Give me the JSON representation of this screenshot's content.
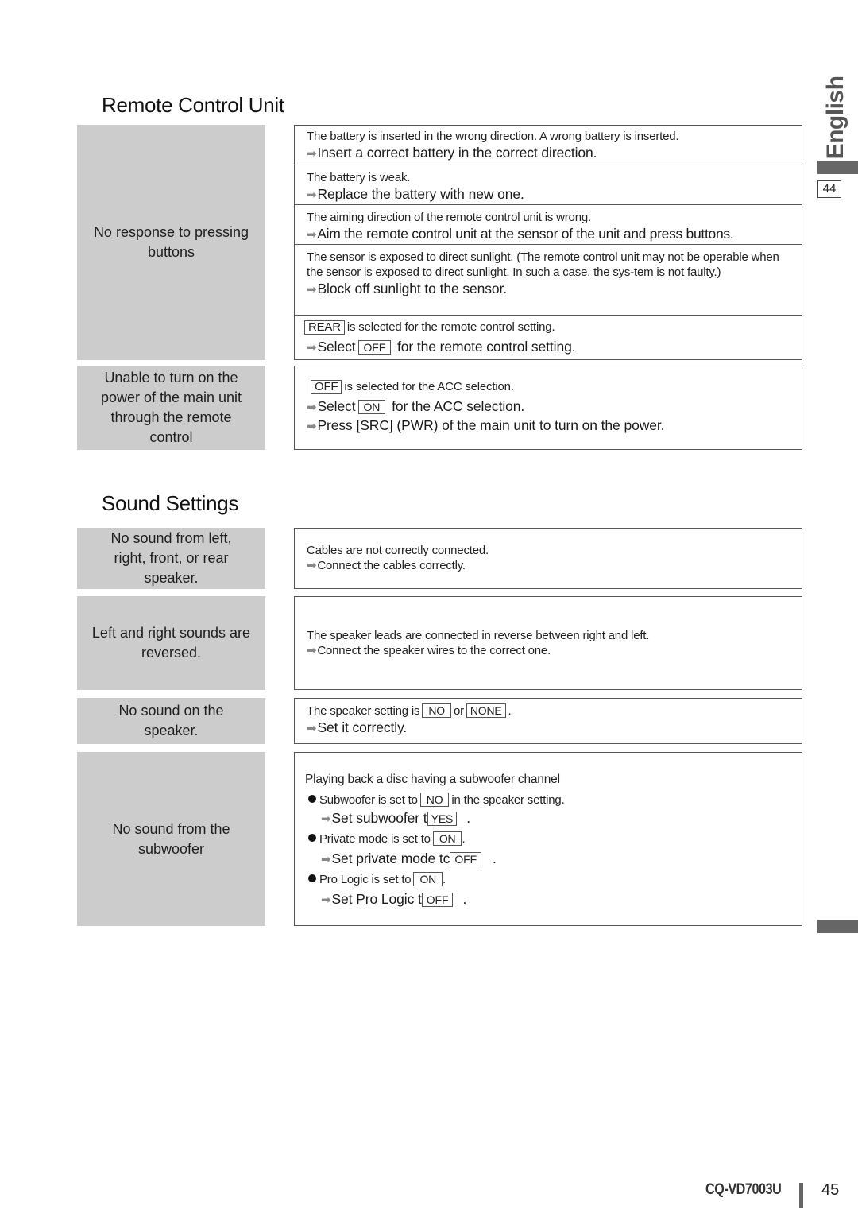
{
  "side_tab": {
    "language": "English",
    "page_ref": "44"
  },
  "footer": {
    "model": "CQ-VD7003U",
    "page_number": "45"
  },
  "sections": [
    {
      "title": "Remote Control Unit",
      "rows": [
        {
          "symptom": "No response to pressing buttons",
          "remedies": [
            {
              "cause": "The battery is inserted in the wrong direction. A wrong battery is inserted.",
              "fix": "Insert a correct battery in the correct direction."
            },
            {
              "cause": "The battery is weak.",
              "fix": "Replace the battery with new one."
            },
            {
              "cause": "The aiming direction of the remote control unit is wrong.",
              "fix": "Aim the remote control unit at the sensor of the unit and press buttons."
            },
            {
              "cause": "The sensor is exposed to direct sunlight. (The remote control unit may not be operable when the sensor is exposed to direct sunlight. In such a case, the sys-tem is not faulty.)",
              "fix": "Block off sunlight to the sensor."
            },
            {
              "cause_box": "REAR",
              "cause": "is selected for the remote control setting.",
              "fix_pre": "Select",
              "fix_box": "OFF",
              "fix": "for the remote control setting."
            }
          ]
        },
        {
          "symptom": "Unable to turn on the power of the main unit through the remote control",
          "remedies": [
            {
              "cause_box": "OFF",
              "cause": "is selected for the ACC selection.",
              "fix_pre": "Select",
              "fix_box": "ON",
              "fix": "for the ACC selection.",
              "fix2": "Press [SRC] (PWR) of the main unit to turn on the power."
            }
          ]
        }
      ]
    },
    {
      "title": "Sound Settings",
      "rows": [
        {
          "symptom": "No sound from left, right, front, or rear speaker.",
          "remedies": [
            {
              "cause": "Cables are not correctly connected.",
              "fix": "Connect the cables correctly."
            }
          ]
        },
        {
          "symptom": "Left and right sounds are reversed.",
          "remedies": [
            {
              "cause": "The speaker leads are connected in reverse between right and left.",
              "fix": "Connect the speaker wires to the correct one."
            }
          ]
        },
        {
          "symptom": "No sound on the speaker.",
          "remedies": [
            {
              "cause_pre": "The speaker setting is",
              "box1": "NO",
              "mid": "or",
              "box2": "NONE",
              "end": ".",
              "fix": "Set it correctly."
            }
          ]
        },
        {
          "symptom": "No sound from the subwoofer",
          "remedies": [
            {
              "intro": "Playing back a disc having a subwoofer channel",
              "items": [
                {
                  "cause_pre": "Subwoofer is set to",
                  "cause_box": "NO",
                  "cause_post": "in the speaker setting.",
                  "fix_pre": "Set subwoofer t",
                  "fix_box": "YES",
                  "fix_post": "."
                },
                {
                  "cause_pre": "Private mode is set to",
                  "cause_box": "ON",
                  "cause_post": ".",
                  "fix_pre": "Set private mode tc",
                  "fix_box": "OFF",
                  "fix_post": "."
                },
                {
                  "cause_pre": "Pro Logic is set to",
                  "cause_box": "ON",
                  "cause_post": ".",
                  "fix_pre": "Set Pro Logic t",
                  "fix_box": "OFF",
                  "fix_post": "."
                }
              ]
            }
          ]
        }
      ]
    }
  ],
  "arrow_glyph": "➡"
}
